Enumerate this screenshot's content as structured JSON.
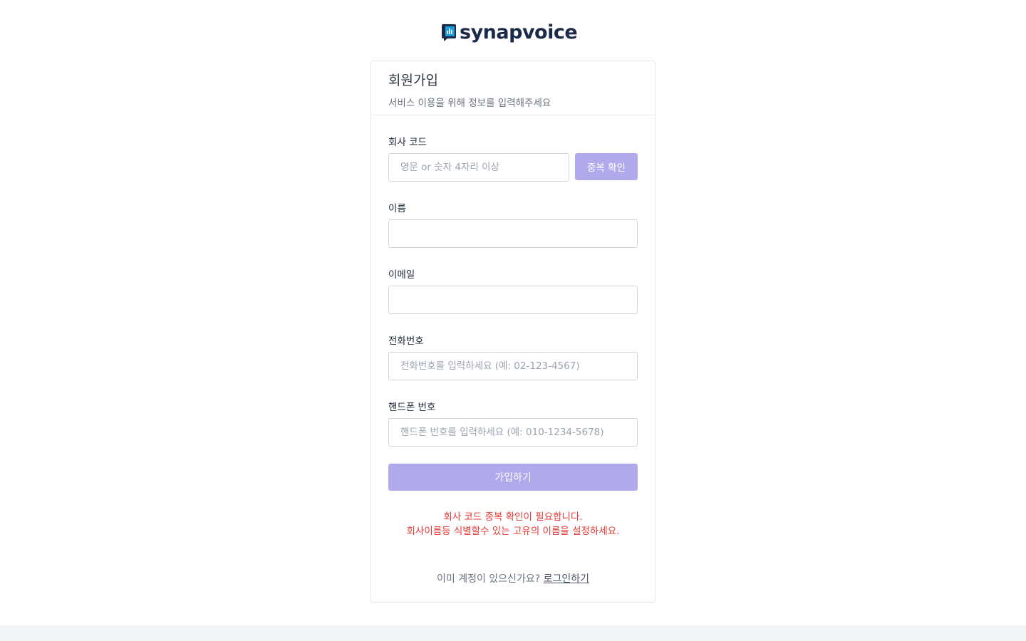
{
  "brand": {
    "name": "synapvoice",
    "colors": {
      "text": "#1c2a4a",
      "mark": "#1a9fd8"
    }
  },
  "form": {
    "title": "회원가입",
    "subtitle": "서비스 이용을 위해 정보를 입력해주세요",
    "company_code": {
      "label": "회사 코드",
      "placeholder": "영문 or 숫자 4자리 이상",
      "value": "",
      "check_button": "중복 확인"
    },
    "name": {
      "label": "이름",
      "placeholder": "",
      "value": ""
    },
    "email": {
      "label": "이메일",
      "placeholder": "",
      "value": ""
    },
    "phone": {
      "label": "전화번호",
      "placeholder": "전화번호를 입력하세요 (예: 02-123-4567)",
      "value": ""
    },
    "mobile": {
      "label": "핸드폰 번호",
      "placeholder": "핸드폰 번호를 입력하세요 (예: 010-1234-5678)",
      "value": ""
    },
    "submit_label": "가입하기",
    "errors": [
      "회사 코드 중복 확인이 필요합니다.",
      "회사이름등 식별할수 있는 고유의 이름을 설정하세요."
    ],
    "login_prompt": "이미 계정이 있으신가요?",
    "login_link": "로그인하기"
  },
  "colors": {
    "button_disabled": "#b0aaec",
    "error": "#e53935"
  }
}
